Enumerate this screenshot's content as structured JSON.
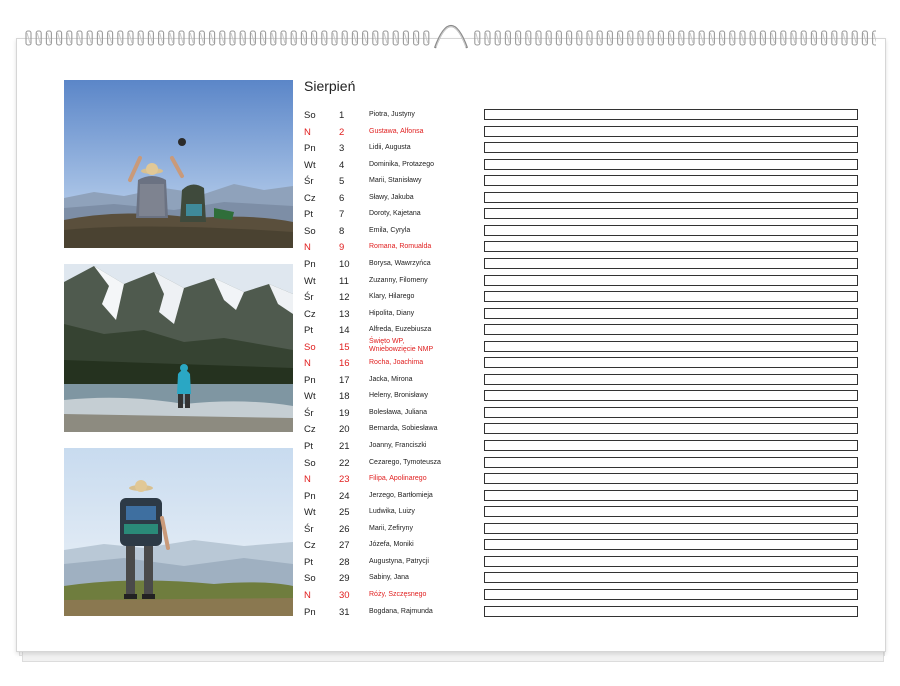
{
  "calendar": {
    "month": "Sierpień",
    "accent_color": "#e02020",
    "days": [
      {
        "dow": "So",
        "day": "1",
        "names": "Piotra, Justyny",
        "holiday": false
      },
      {
        "dow": "N",
        "day": "2",
        "names": "Gustawa, Alfonsa",
        "holiday": true
      },
      {
        "dow": "Pn",
        "day": "3",
        "names": "Lidii, Augusta",
        "holiday": false
      },
      {
        "dow": "Wt",
        "day": "4",
        "names": "Dominika, Protazego",
        "holiday": false
      },
      {
        "dow": "Śr",
        "day": "5",
        "names": "Marii, Stanisławy",
        "holiday": false
      },
      {
        "dow": "Cz",
        "day": "6",
        "names": "Sławy, Jakuba",
        "holiday": false
      },
      {
        "dow": "Pt",
        "day": "7",
        "names": "Doroty, Kajetana",
        "holiday": false
      },
      {
        "dow": "So",
        "day": "8",
        "names": "Emila, Cyryla",
        "holiday": false
      },
      {
        "dow": "N",
        "day": "9",
        "names": "Romana, Romualda",
        "holiday": true
      },
      {
        "dow": "Pn",
        "day": "10",
        "names": "Borysa, Wawrzyńca",
        "holiday": false
      },
      {
        "dow": "Wt",
        "day": "11",
        "names": "Zuzanny, Filomeny",
        "holiday": false
      },
      {
        "dow": "Śr",
        "day": "12",
        "names": "Klary, Hilarego",
        "holiday": false
      },
      {
        "dow": "Cz",
        "day": "13",
        "names": "Hipolita, Diany",
        "holiday": false
      },
      {
        "dow": "Pt",
        "day": "14",
        "names": "Alfreda, Euzebiusza",
        "holiday": false
      },
      {
        "dow": "So",
        "day": "15",
        "names": "Święto WP, Wniebowzięcie NMP",
        "holiday": true,
        "two_line": true
      },
      {
        "dow": "N",
        "day": "16",
        "names": "Rocha, Joachima",
        "holiday": true
      },
      {
        "dow": "Pn",
        "day": "17",
        "names": "Jacka, Mirona",
        "holiday": false
      },
      {
        "dow": "Wt",
        "day": "18",
        "names": "Heleny, Bronisławy",
        "holiday": false
      },
      {
        "dow": "Śr",
        "day": "19",
        "names": "Bolesława, Juliana",
        "holiday": false
      },
      {
        "dow": "Cz",
        "day": "20",
        "names": "Bernarda, Sobiesława",
        "holiday": false
      },
      {
        "dow": "Pt",
        "day": "21",
        "names": "Joanny, Franciszki",
        "holiday": false
      },
      {
        "dow": "So",
        "day": "22",
        "names": "Cezarego, Tymoteusza",
        "holiday": false
      },
      {
        "dow": "N",
        "day": "23",
        "names": "Filipa, Apolinarego",
        "holiday": true
      },
      {
        "dow": "Pn",
        "day": "24",
        "names": "Jerzego, Bartłomieja",
        "holiday": false
      },
      {
        "dow": "Wt",
        "day": "25",
        "names": "Ludwika, Luizy",
        "holiday": false
      },
      {
        "dow": "Śr",
        "day": "26",
        "names": "Marii, Zefiryny",
        "holiday": false
      },
      {
        "dow": "Cz",
        "day": "27",
        "names": "Józefa, Moniki",
        "holiday": false
      },
      {
        "dow": "Pt",
        "day": "28",
        "names": "Augustyna, Patrycji",
        "holiday": false
      },
      {
        "dow": "So",
        "day": "29",
        "names": "Sabiny, Jana",
        "holiday": false
      },
      {
        "dow": "N",
        "day": "30",
        "names": "Róży, Szczęsnego",
        "holiday": true
      },
      {
        "dow": "Pn",
        "day": "31",
        "names": "Bogdana, Rajmunda",
        "holiday": false
      }
    ]
  },
  "photos": [
    {
      "name": "hiker-arms-raised-photo"
    },
    {
      "name": "mountain-lake-photo"
    },
    {
      "name": "hiker-backpack-photo"
    }
  ]
}
